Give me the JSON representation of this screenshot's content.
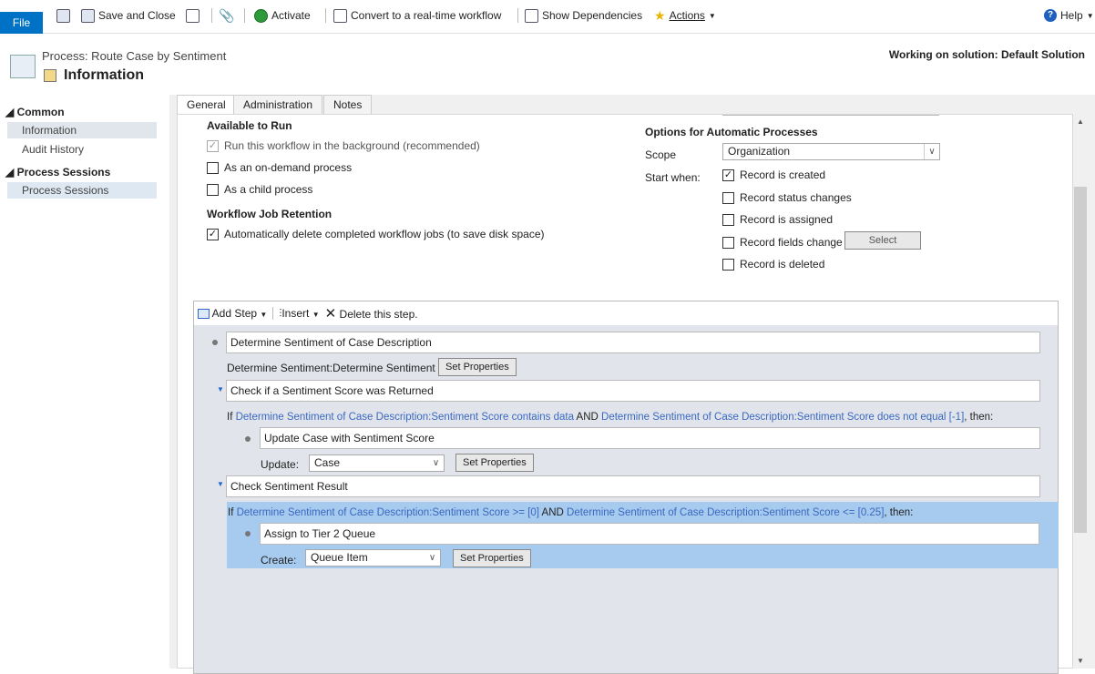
{
  "toolbar": {
    "file": "File",
    "save_close": "Save and Close",
    "activate": "Activate",
    "convert": "Convert to a real-time workflow",
    "show_dependencies": "Show Dependencies",
    "actions": "Actions",
    "help": "Help"
  },
  "header": {
    "subtitle": "Process: Route Case by Sentiment",
    "title": "Information",
    "solution": "Working on solution: Default Solution"
  },
  "sidebar": {
    "groups": [
      {
        "label": "Common",
        "items": [
          "Information",
          "Audit History"
        ]
      },
      {
        "label": "Process Sessions",
        "items": [
          "Process Sessions"
        ]
      }
    ]
  },
  "tabs": [
    "General",
    "Administration",
    "Notes"
  ],
  "general": {
    "available_title": "Available to Run",
    "run_background": {
      "label": "Run this workflow in the background (recommended)",
      "checked": true,
      "disabled": true
    },
    "on_demand": {
      "label": "As an on-demand process",
      "checked": false
    },
    "child": {
      "label": "As a child process",
      "checked": false
    },
    "retention_title": "Workflow Job Retention",
    "auto_delete": {
      "label": "Automatically delete completed workflow jobs (to save disk space)",
      "checked": true
    },
    "options_title": "Options for Automatic Processes",
    "scope_label": "Scope",
    "scope_value": "Organization",
    "start_when_label": "Start when:",
    "start_when": [
      {
        "label": "Record is created",
        "checked": true
      },
      {
        "label": "Record status changes",
        "checked": false
      },
      {
        "label": "Record is assigned",
        "checked": false
      },
      {
        "label": "Record fields change",
        "checked": false
      },
      {
        "label": "Record is deleted",
        "checked": false
      }
    ],
    "select_button": "Select"
  },
  "designer": {
    "add_step": "Add Step",
    "insert": "Insert",
    "delete": "Delete this step.",
    "step1": "Determine Sentiment of Case Description",
    "step1_action": "Determine Sentiment:Determine Sentiment",
    "set_properties": "Set Properties",
    "check1": "Check if a Sentiment Score was Returned",
    "cond1": {
      "if": "If ",
      "a": "Determine Sentiment of Case Description:Sentiment Score contains data",
      "and": " AND ",
      "b": "Determine Sentiment of Case Description:Sentiment Score does not equal [-1]",
      "then": ", then:"
    },
    "update_step": "Update Case with Sentiment Score",
    "update_label": "Update:",
    "update_value": "Case",
    "check2": "Check Sentiment Result",
    "cond2": {
      "if": "If ",
      "a": "Determine Sentiment of Case Description:Sentiment Score >= [0]",
      "and": " AND ",
      "b": "Determine Sentiment of Case Description:Sentiment Score <= [0.25]",
      "then": ", then:"
    },
    "assign_step": "Assign to Tier 2 Queue",
    "create_label": "Create:",
    "create_value": "Queue Item"
  },
  "colors": {
    "file_tab": "#0072c6",
    "highlight": "#a7cbee",
    "condition_link": "#3a68c0"
  }
}
